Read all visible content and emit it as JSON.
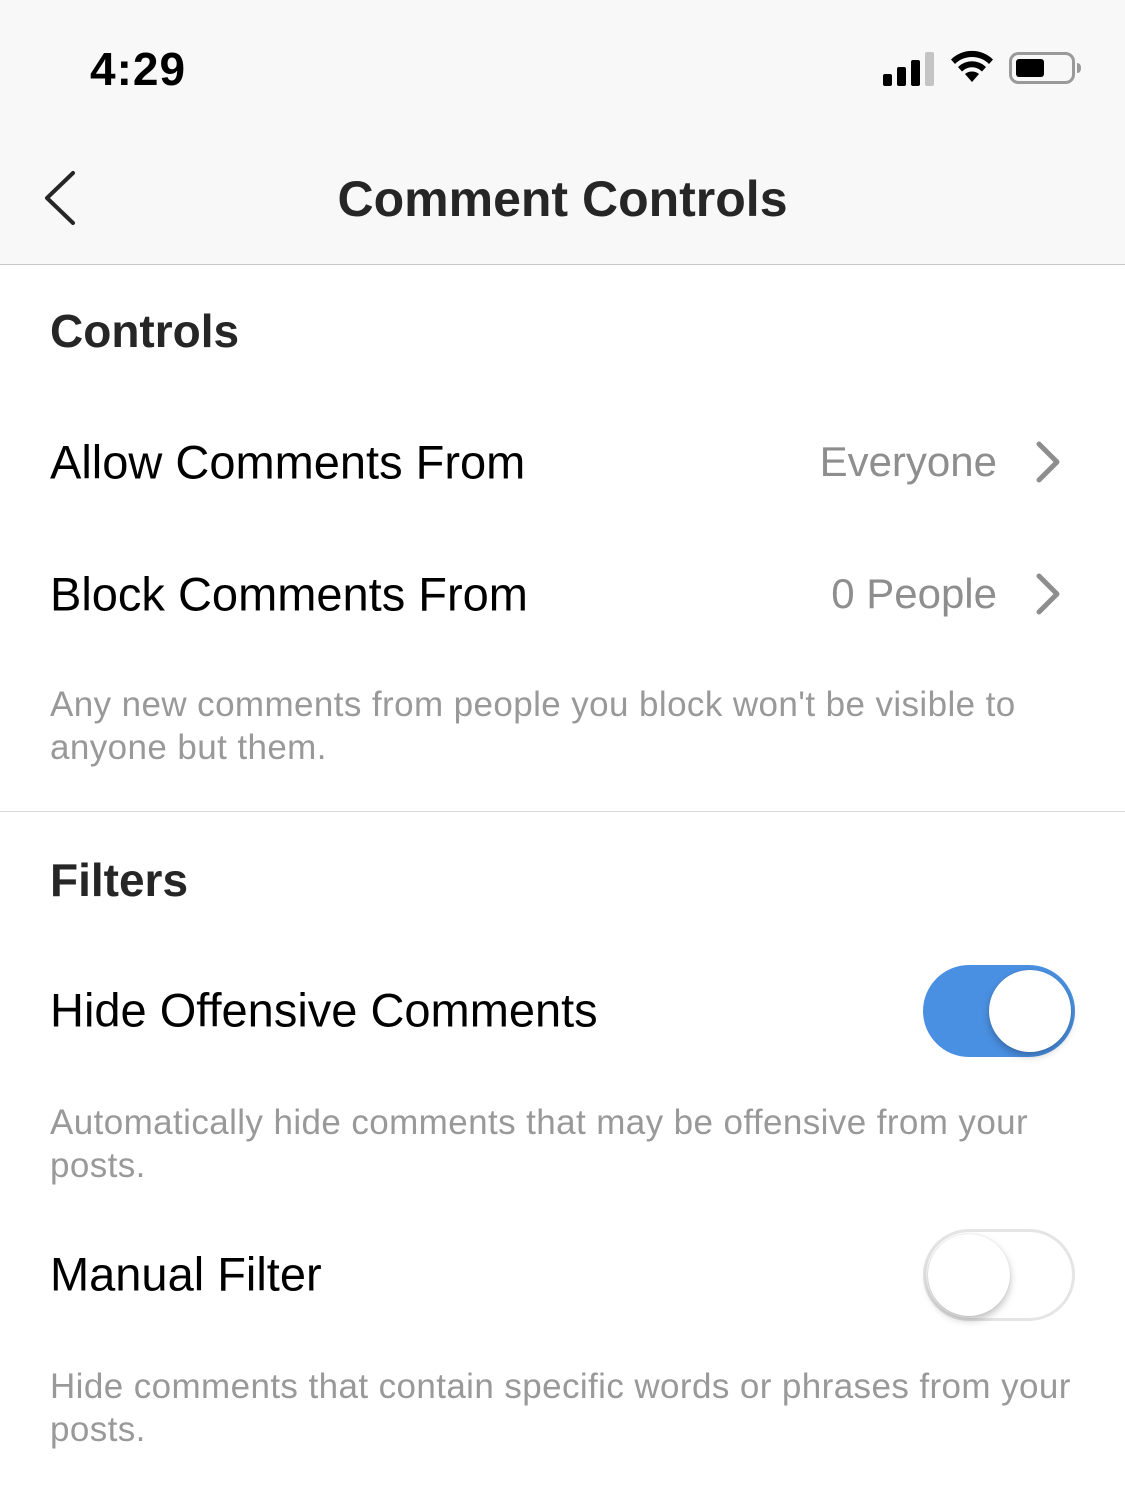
{
  "status_bar": {
    "time": "4:29",
    "icons": [
      "signal-icon",
      "wifi-icon",
      "battery-icon"
    ]
  },
  "nav": {
    "back_icon": "chevron-left-icon",
    "title": "Comment Controls"
  },
  "controls": {
    "header": "Controls",
    "allow_comments": {
      "label": "Allow Comments From",
      "value": "Everyone"
    },
    "block_comments": {
      "label": "Block Comments From",
      "value": "0 People"
    },
    "description": "Any new comments from people you block won't be visible to anyone but them."
  },
  "filters": {
    "header": "Filters",
    "hide_offensive": {
      "label": "Hide Offensive Comments",
      "enabled": true,
      "description": "Automatically hide comments that may be offensive from your posts."
    },
    "manual_filter": {
      "label": "Manual Filter",
      "enabled": false,
      "description": "Hide comments that contain specific words or phrases from your posts."
    }
  },
  "colors": {
    "accent": "#4a90e2",
    "secondary_text": "#8e8e8e",
    "bar_background": "#f8f8f8"
  }
}
